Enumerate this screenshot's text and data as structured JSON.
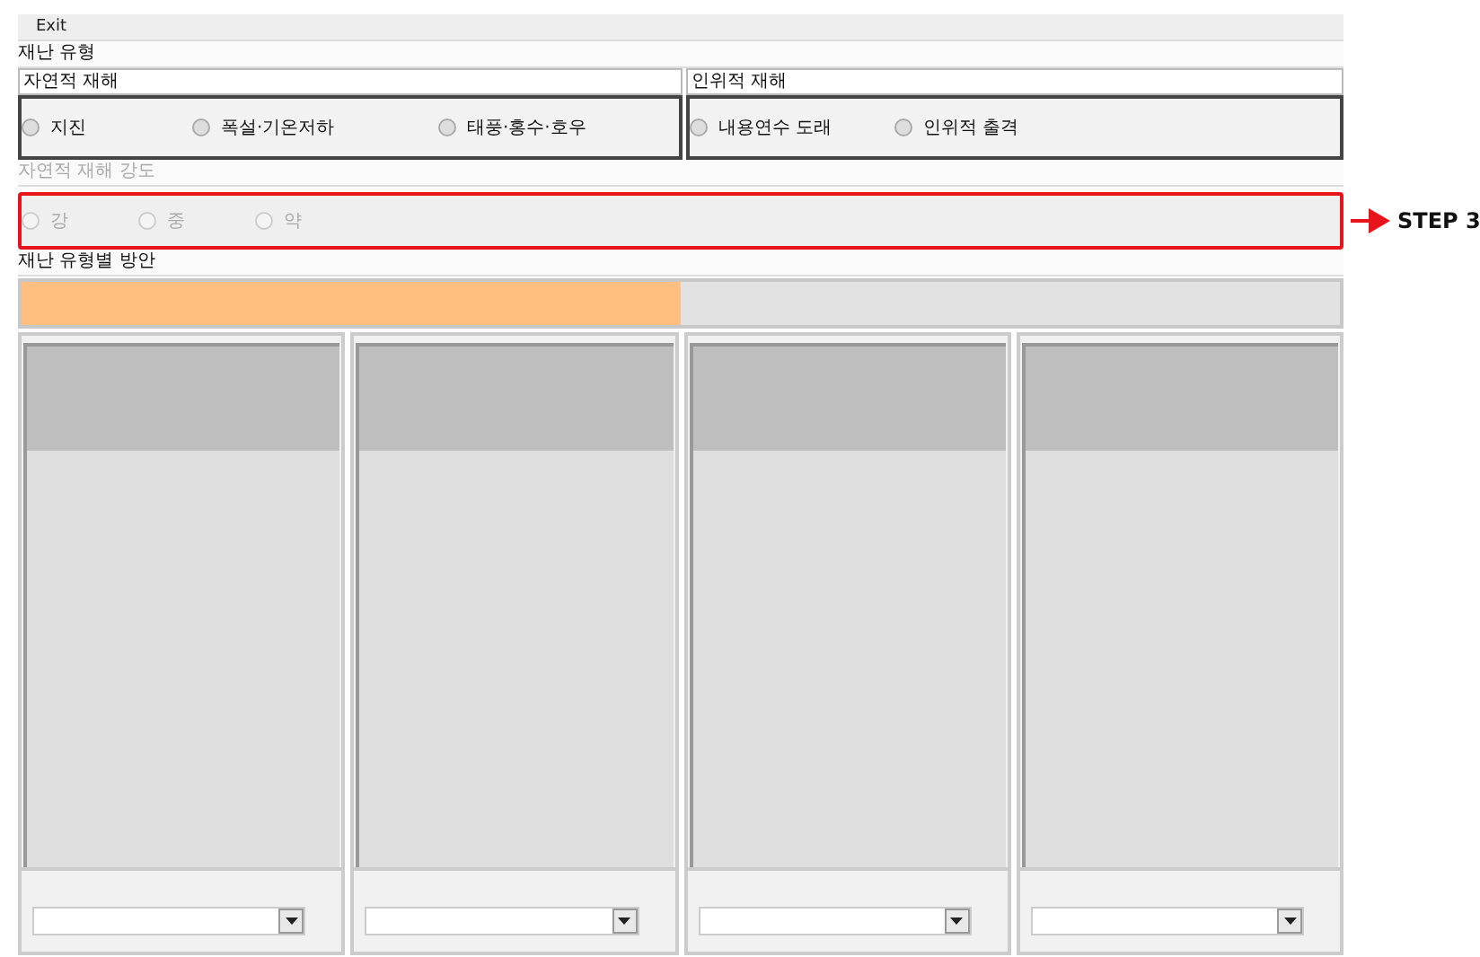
{
  "menu": [
    {
      "label": "Exit"
    }
  ],
  "disaster_type": {
    "title": "재난 유형",
    "groups": [
      {
        "title": "자연적 재해",
        "options": [
          {
            "label": "지진",
            "selected": false
          },
          {
            "label": "폭설·기온저하",
            "selected": false
          },
          {
            "label": "태풍·홍수·호우",
            "selected": false
          }
        ]
      },
      {
        "title": "인위적 재해",
        "options": [
          {
            "label": "내용연수 도래",
            "selected": false
          },
          {
            "label": "인위적 출격",
            "selected": false
          }
        ]
      }
    ]
  },
  "intensity": {
    "title": "자연적 재해 강도",
    "disabled": true,
    "options": [
      {
        "label": "강",
        "selected": false
      },
      {
        "label": "중",
        "selected": false
      },
      {
        "label": "약",
        "selected": false
      }
    ]
  },
  "annotation": {
    "label": "STEP 3"
  },
  "plans": {
    "title": "재난 유형별 방안",
    "progress": {
      "level": 0.5
    },
    "panels": [
      {
        "kind": "dropdown-panel"
      },
      {
        "kind": "dropdown-panel"
      },
      {
        "kind": "dropdown-panel"
      },
      {
        "kind": "dropdown-panel"
      }
    ]
  }
}
